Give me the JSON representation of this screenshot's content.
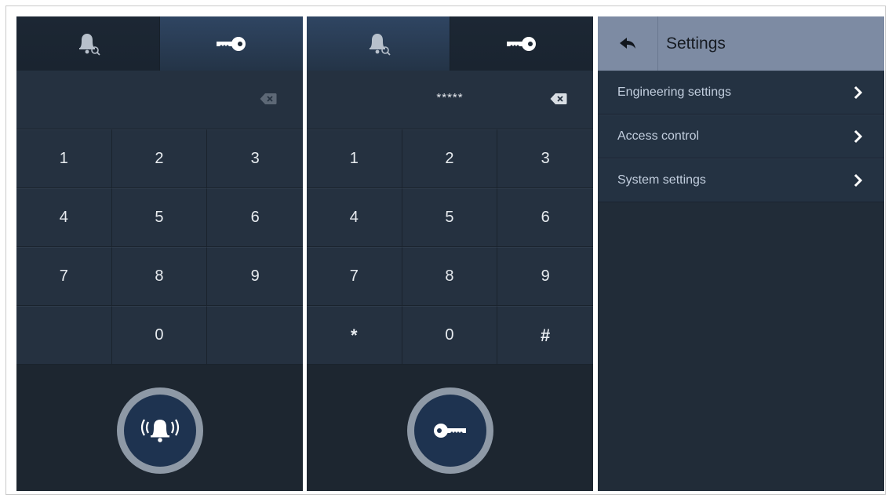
{
  "panel_left": {
    "tabs": [
      {
        "icon": "bell-search-icon",
        "active": true
      },
      {
        "icon": "key-icon",
        "active": false
      }
    ],
    "display_value": "",
    "backspace_icon": "backspace-icon",
    "keys": [
      "1",
      "2",
      "3",
      "4",
      "5",
      "6",
      "7",
      "8",
      "9",
      "",
      "0",
      ""
    ],
    "action_button_icon": "ringing-bell-icon"
  },
  "panel_middle": {
    "tabs": [
      {
        "icon": "bell-search-icon",
        "active": false
      },
      {
        "icon": "key-icon",
        "active": true
      }
    ],
    "display_value": "*****",
    "backspace_icon": "backspace-icon",
    "keys": [
      "1",
      "2",
      "3",
      "4",
      "5",
      "6",
      "7",
      "8",
      "9",
      "*",
      "0",
      "#"
    ],
    "action_button_icon": "key-icon"
  },
  "panel_right": {
    "header": {
      "title": "Settings",
      "back_icon": "back-arrow-icon"
    },
    "menu": [
      {
        "label": "Engineering settings",
        "icon": "chevron-right-icon"
      },
      {
        "label": "Access control",
        "icon": "chevron-right-icon"
      },
      {
        "label": "System settings",
        "icon": "chevron-right-icon"
      }
    ]
  },
  "colors": {
    "panel_bg": "#212c38",
    "header_bg": "#7d8ba3",
    "accent_ring": "#8e99a6",
    "button_inner": "#1e3350"
  }
}
